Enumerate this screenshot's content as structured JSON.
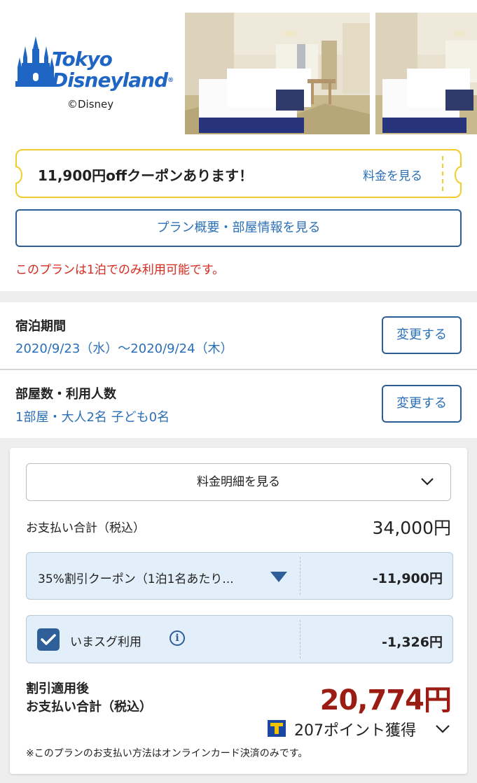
{
  "header": {
    "logo_line1": "Tokyo",
    "logo_line2": "Disneyland",
    "logo_reg": "®",
    "logo_copyright": "©Disney",
    "photos": [
      "hotel-room-photo",
      "hotel-room-photo"
    ]
  },
  "coupon": {
    "text": "11,900円offクーポンあります！",
    "link": "料金を見る",
    "border_color": "#f1cd2b"
  },
  "plan": {
    "button_label": "プラン概要・部屋情報を見る",
    "note": "このプランは1泊でのみ利用可能です。"
  },
  "stay": {
    "period_title": "宿泊期間",
    "period_value": "2020/9/23（水）〜2020/9/24（木）",
    "period_change": "変更する",
    "rooms_title": "部屋数・利用人数",
    "rooms_value": "1部屋・大人2名 子ども0名",
    "rooms_change": "変更する"
  },
  "price": {
    "detail_button": "料金明細を見る",
    "total_label": "お支払い合計（税込）",
    "total_value": "34,000円",
    "coupon_label": "35%割引クーポン（1泊1名あたり...",
    "coupon_amount": "-11,900円",
    "imasugu_label": "いまスグ利用",
    "imasugu_checked": true,
    "imasugu_amount": "-1,326円",
    "info_symbol": "i",
    "after_label_line1": "割引適用後",
    "after_label_line2": "お支払い合計（税込）",
    "after_value": "20,774円",
    "points_text": "207ポイント獲得",
    "footnote": "※このプランのお支払い方法はオンラインカード決済のみです。"
  },
  "colors": {
    "accent_blue": "#2b6fb6",
    "dark_blue": "#2e5f99",
    "error_red": "#d8291f",
    "price_red": "#9b1c12",
    "discount_bg": "#e2eef9"
  }
}
